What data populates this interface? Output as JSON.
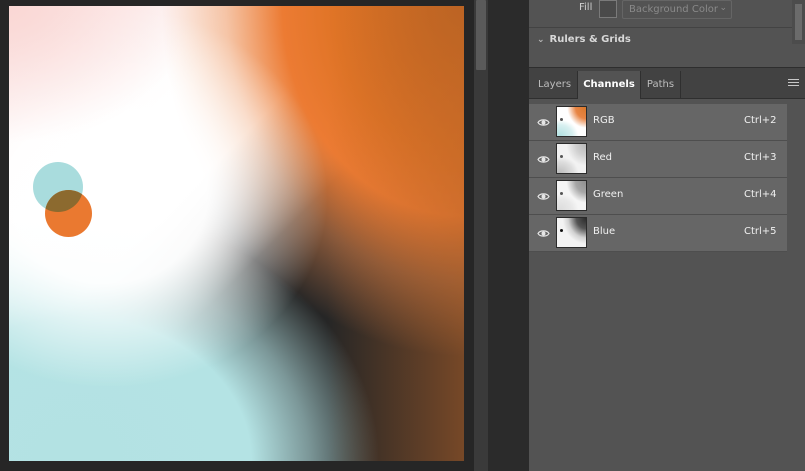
{
  "properties": {
    "fill_label": "Fill",
    "fill_select_value": "Background Color",
    "rulers_label": "Rulers & Grids"
  },
  "tabs": [
    {
      "label": "Layers",
      "active": false
    },
    {
      "label": "Channels",
      "active": true
    },
    {
      "label": "Paths",
      "active": false
    }
  ],
  "channels": [
    {
      "name": "RGB",
      "shortcut": "Ctrl+2"
    },
    {
      "name": "Red",
      "shortcut": "Ctrl+3"
    },
    {
      "name": "Green",
      "shortcut": "Ctrl+4"
    },
    {
      "name": "Blue",
      "shortcut": "Ctrl+5"
    }
  ],
  "icons": {
    "visibility": "eye-icon",
    "panel_menu": "hamburger-menu-icon",
    "dropdown": "chevron-down-icon",
    "collapse": "chevron-down-icon"
  },
  "colors": {
    "accent_orange": "#ec7b33",
    "accent_cyan": "#b3e2e3",
    "panel_bg": "#535353",
    "row_bg": "#666666"
  }
}
